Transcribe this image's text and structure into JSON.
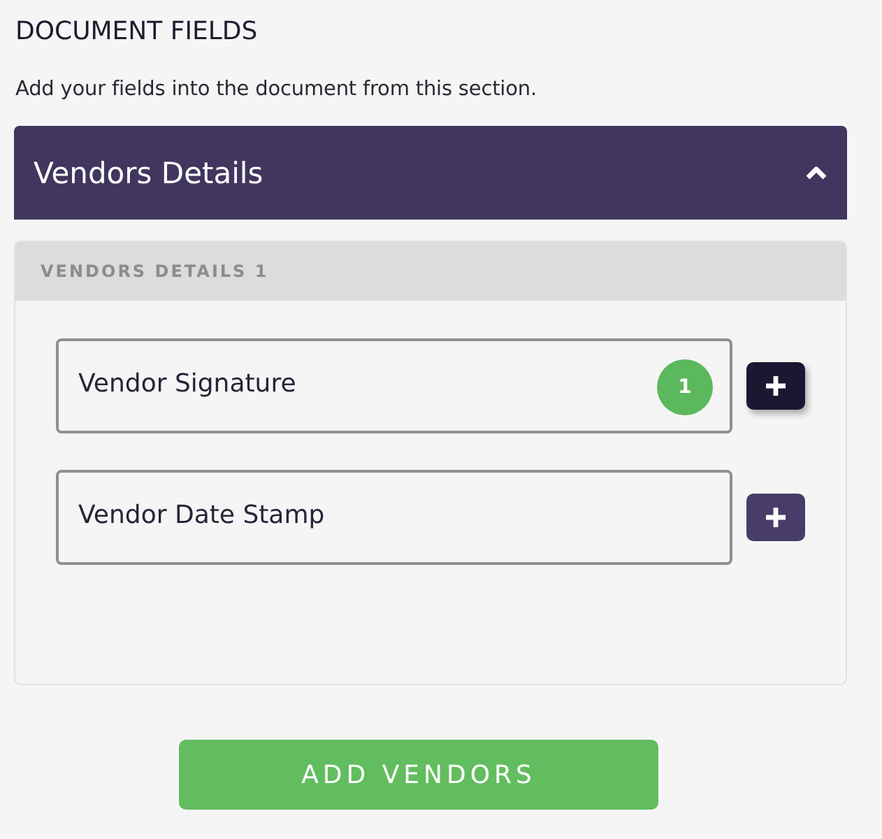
{
  "heading": "DOCUMENT FIELDS",
  "description": "Add your fields into the document from this section.",
  "section": {
    "title": "Vendors Details",
    "expanded": true,
    "group": {
      "title": "VENDORS DETAILS 1",
      "fields": [
        {
          "label": "Vendor Signature",
          "count": "1",
          "active": true
        },
        {
          "label": "Vendor Date Stamp",
          "active": false
        }
      ]
    }
  },
  "button": "ADD VENDORS"
}
